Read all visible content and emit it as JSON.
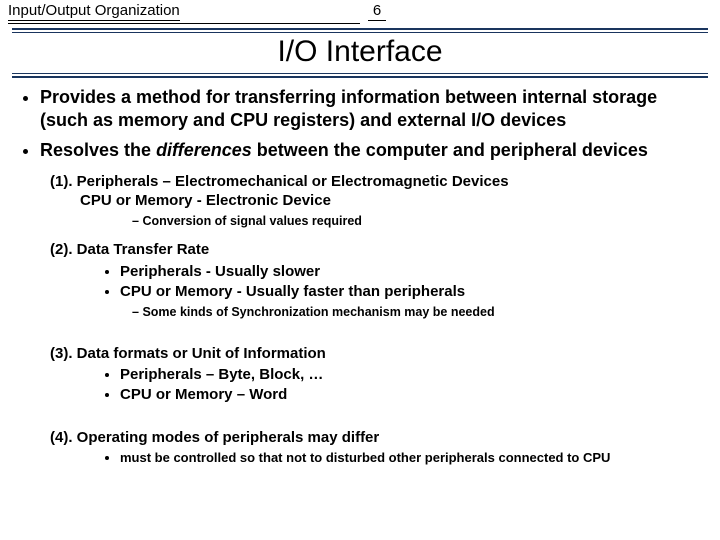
{
  "header": {
    "left": "Input/Output Organization",
    "page_number": "6"
  },
  "title": "I/O Interface",
  "bullets": [
    "Provides a method for transferring information between internal storage (such as memory and CPU registers) and external I/O devices",
    {
      "pre": "Resolves the ",
      "em": "differences",
      "post": "  between the computer and peripheral devices"
    }
  ],
  "items": [
    {
      "label": "(1).  Peripherals – Electromechanical or Electromagnetic Devices",
      "sub_line": "CPU or Memory - Electronic Device",
      "dash": [
        "Conversion of signal values required"
      ]
    },
    {
      "label": "(2).  Data Transfer Rate",
      "bullets": [
        "Peripherals - Usually slower",
        "CPU or Memory - Usually faster than peripherals"
      ],
      "dash": [
        "Some kinds of Synchronization mechanism may be needed"
      ]
    },
    {
      "label": "(3).  Data formats or Unit of Information",
      "bullets": [
        "Peripherals – Byte, Block, …",
        "CPU or Memory – Word"
      ]
    },
    {
      "label": "(4).  Operating modes of peripherals may differ",
      "bullets": [
        "must be controlled so that not to disturbed other peripherals connected to CPU"
      ]
    }
  ]
}
